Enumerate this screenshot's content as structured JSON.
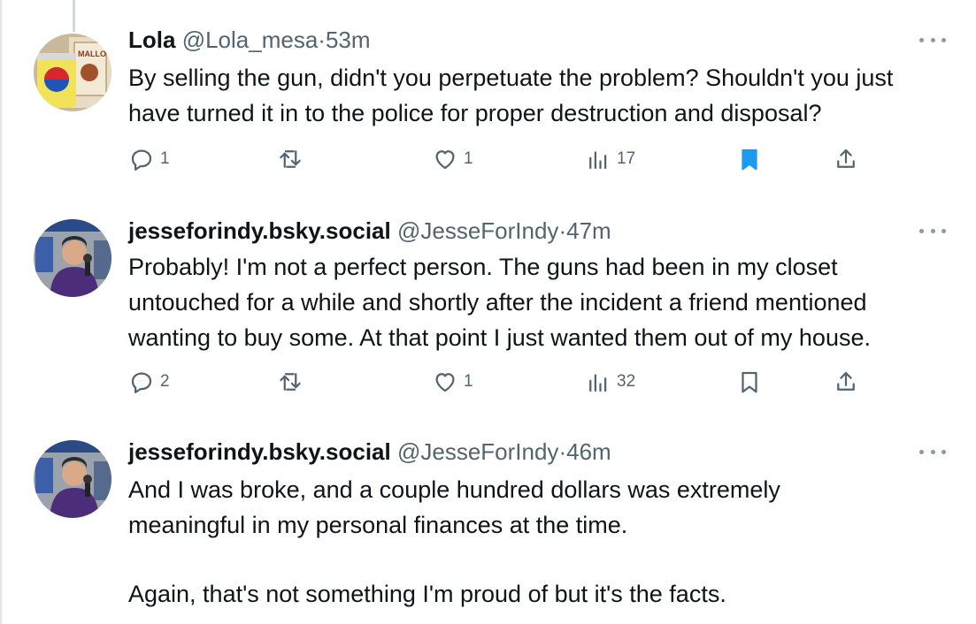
{
  "tweets": [
    {
      "author_name": "Lola",
      "handle": "@Lola_mesa",
      "separator": "·",
      "time": "53m",
      "text": [
        "By selling the gun, didn't you perpetuate the problem? Shouldn't you just have turned it in to the police for proper destruction and disposal?"
      ],
      "replies": "1",
      "retweets": "",
      "likes": "1",
      "views": "17",
      "bookmarked": true,
      "avatar": "lola-avatar"
    },
    {
      "author_name": "jesseforindy.bsky.social",
      "handle": "@JesseForIndy",
      "separator": "·",
      "time": "47m",
      "text": [
        "Probably! I'm not a perfect person. The guns had been in my closet untouched for a while and shortly after the incident a friend mentioned wanting to buy some. At that point I just wanted them out of my house."
      ],
      "replies": "2",
      "retweets": "",
      "likes": "1",
      "views": "32",
      "bookmarked": false,
      "avatar": "jesse-avatar"
    },
    {
      "author_name": "jesseforindy.bsky.social",
      "handle": "@JesseForIndy",
      "separator": "·",
      "time": "46m",
      "text": [
        "And I was broke, and a couple hundred dollars was extremely meaningful in my personal finances at the time.",
        "Again, that's not something I'm proud of but it's the facts."
      ],
      "avatar": "jesse-avatar"
    }
  ],
  "colors": {
    "text": "#0f1419",
    "secondary": "#536471",
    "accent": "#1d9bf0",
    "thread_line": "#cfd9de"
  },
  "icons": {
    "reply": "reply-icon",
    "retweet": "retweet-icon",
    "like": "heart-icon",
    "views": "views-icon",
    "bookmark": "bookmark-icon",
    "share": "share-icon",
    "more": "more-icon"
  }
}
